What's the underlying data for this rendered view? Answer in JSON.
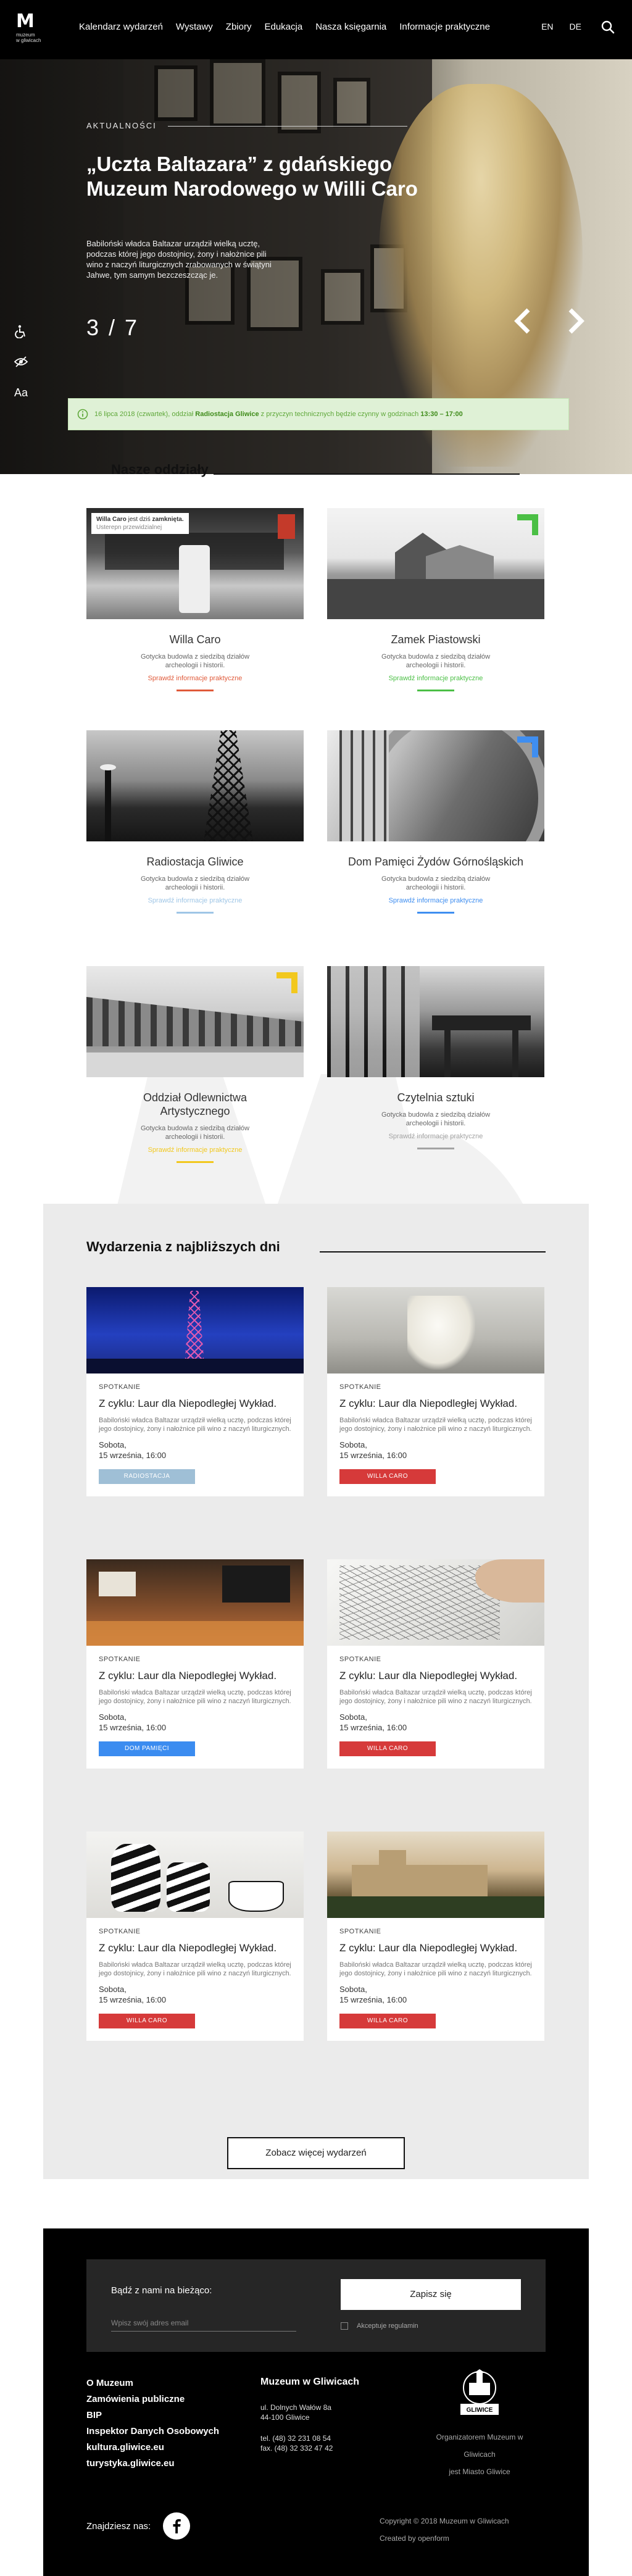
{
  "nav": {
    "logo_mark": "M",
    "logo_sub": "muzeum\nw gliwicach",
    "items": [
      "Kalendarz wydarzeń",
      "Wystawy",
      "Zbiory",
      "Edukacja",
      "Nasza księgarnia",
      "Informacje praktyczne"
    ],
    "langs": [
      "EN",
      "DE"
    ]
  },
  "hero": {
    "kicker": "AKTUALNOŚCI",
    "title": "„Uczta Baltazara” z gdańskiego Muzeum Narodowego w Willi Caro",
    "text": "Babiloński władca Baltazar urządził wielką ucztę, podczas której jego dostojnicy, żony i nałożnice pili wino z naczyń liturgicznych zrabowanych w świątyni Jahwe, tym samym bezczeszcząc je.",
    "counter": "3 / 7"
  },
  "side_tools": [
    "Aa"
  ],
  "alert": {
    "prefix": "16 lipca 2018 (czwartek), oddział",
    "branch": "Radiostacja Gliwice",
    "middle": "z przyczyn technicznych będzie czynny w godzinach",
    "hours": "13:30 – 17:00"
  },
  "branches": {
    "title": "Nasze oddziały",
    "items": [
      {
        "name": "Willa Caro",
        "desc": "Gotycka budowla z siedzibą działów archeologii i historii.",
        "more": "Sprawdź informacje praktyczne",
        "color": "#e05a3a",
        "status": {
          "name": "Willa Caro",
          "text": "jest dziś",
          "state": "zamknięta.",
          "reason": "Usterepn przewidzialnej"
        }
      },
      {
        "name": "Zamek Piastowski",
        "desc": "Gotycka budowla z siedzibą działów archeologii i historii.",
        "more": "Sprawdź informacje praktyczne",
        "color": "#4bbf45"
      },
      {
        "name": "Radiostacja Gliwice",
        "desc": "Gotycka budowla z siedzibą działów archeologii i historii.",
        "more": "Sprawdź informacje praktyczne",
        "color": "#9fc6e6"
      },
      {
        "name": "Dom Pamięci Żydów Górnośląskich",
        "desc": "Gotycka budowla z siedzibą działów archeologii i historii.",
        "more": "Sprawdź informacje praktyczne",
        "color": "#3f8ef0"
      },
      {
        "name": "Oddział Odlewnictwa Artystycznego",
        "desc": "Gotycka budowla z siedzibą działów archeologii i historii.",
        "more": "Sprawdź informacje praktyczne",
        "color": "#f2c81e"
      },
      {
        "name": "Czytelnia sztuki",
        "desc": "Gotycka budowla z siedzibą działów archeologii i historii.",
        "more": "Sprawdź informacje praktyczne",
        "color": "#a3a3a3"
      }
    ]
  },
  "events": {
    "title": "Wydarzenia z najbliższych dni",
    "items": [
      {
        "kind": "SPOTKANIE",
        "title": "Z cyklu: Laur dla Niepodległej Wykład.",
        "desc": "Babiloński władca Baltazar urządził wielką ucztę, podczas której jego dostojnicy, żony i nałożnice pili wino z naczyń liturgicznych.",
        "day": "Sobota,",
        "when": "15 września, 16:00",
        "tag": "RADIOSTACJA",
        "tag_color": "#9fbfd6"
      },
      {
        "kind": "SPOTKANIE",
        "title": "Z cyklu: Laur dla Niepodległej Wykład.",
        "desc": "Babiloński władca Baltazar urządził wielką ucztę, podczas której jego dostojnicy, żony i nałożnice pili wino z naczyń liturgicznych.",
        "day": "Sobota,",
        "when": "15 września, 16:00",
        "tag": "WILLA CARO",
        "tag_color": "#d63a3a"
      },
      {
        "kind": "SPOTKANIE",
        "title": "Z cyklu: Laur dla Niepodległej Wykład.",
        "desc": "Babiloński władca Baltazar urządził wielką ucztę, podczas której jego dostojnicy, żony i nałożnice pili wino z naczyń liturgicznych.",
        "day": "Sobota,",
        "when": "15 września, 16:00",
        "tag": "DOM PAMIĘCI",
        "tag_color": "#3b8cf0"
      },
      {
        "kind": "SPOTKANIE",
        "title": "Z cyklu: Laur dla Niepodległej Wykład.",
        "desc": "Babiloński władca Baltazar urządził wielką ucztę, podczas której jego dostojnicy, żony i nałożnice pili wino z naczyń liturgicznych.",
        "day": "Sobota,",
        "when": "15 września, 16:00",
        "tag": "WILLA CARO",
        "tag_color": "#d63a3a"
      },
      {
        "kind": "SPOTKANIE",
        "title": "Z cyklu: Laur dla Niepodległej Wykład.",
        "desc": "Babiloński władca Baltazar urządził wielką ucztę, podczas której jego dostojnicy, żony i nałożnice pili wino z naczyń liturgicznych.",
        "day": "Sobota,",
        "when": "15 września, 16:00",
        "tag": "WILLA CARO",
        "tag_color": "#d63a3a"
      },
      {
        "kind": "SPOTKANIE",
        "title": "Z cyklu: Laur dla Niepodległej Wykład.",
        "desc": "Babiloński władca Baltazar urządził wielką ucztę, podczas której jego dostojnicy, żony i nałożnice pili wino z naczyń liturgicznych.",
        "day": "Sobota,",
        "when": "15 września, 16:00",
        "tag": "WILLA CARO",
        "tag_color": "#d63a3a"
      }
    ],
    "more_label": "Zobacz więcej wydarzeń"
  },
  "footer": {
    "newsletter_label": "Bądź z nami na bieżąco:",
    "email_placeholder": "Wpisz swój adres email",
    "subscribe_label": "Zapisz się",
    "consent_label": "Akceptuje regulamin",
    "links": [
      "O Muzeum",
      "Zamówienia publiczne",
      "BIP",
      "Inspektor Danych Osobowych",
      "kultura.gliwice.eu",
      "turystyka.gliwice.eu"
    ],
    "org_name": "Muzeum w Gliwicach",
    "address1": "ul. Dolnych Wałów 8a",
    "address2": "44-100 Gliwice",
    "tel": "tel. (48) 32 231 08 54",
    "fax": "fax. (48) 32 332 47 42",
    "city_badge": "GLIWICE",
    "organizer1": "Organizatorem Muzeum w Gliwicach",
    "organizer2": "jest Miasto Gliwice",
    "social_label": "Znajdziesz nas:",
    "copyright": "Copyright © 2018 Muzeum w Gliwicach",
    "created_by": "Created by openform"
  }
}
